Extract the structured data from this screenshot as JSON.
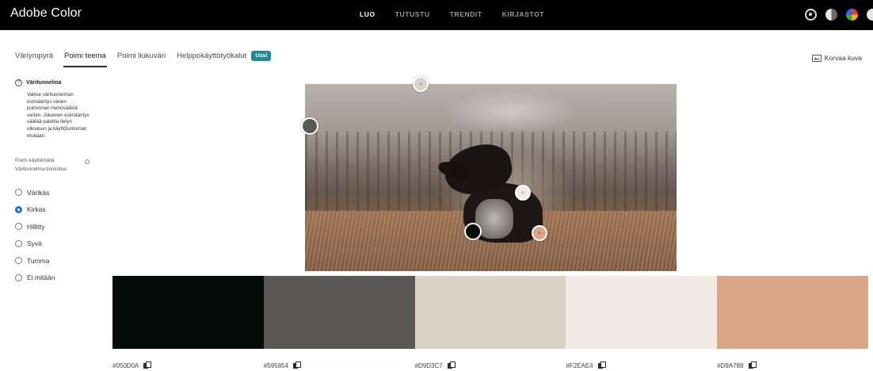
{
  "app": {
    "title": "Adobe Color"
  },
  "topnav": {
    "items": [
      "LUO",
      "TUTUSTU",
      "TRENDIT",
      "KIRJASTOT"
    ],
    "active": "LUO"
  },
  "top_icons": [
    "creative-cloud-icon",
    "contrast-icon",
    "color-wheel-icon",
    "info-icon"
  ],
  "tabs": {
    "items": [
      "Väriympyrä",
      "Poimi teema",
      "Poimi liukuväri",
      "Helppokäyttötyökalut"
    ],
    "active": "Poimi teema",
    "badge": "Uusi"
  },
  "replace_image": {
    "label": "Korvaa kuva"
  },
  "sidebar": {
    "harmony_title": "Väritunnelma",
    "harmony_description": "Valitse väritunnelman esimääritys värien poiminnan hienosäätöä varten. Jokainen esimääritys säätää palettia tietyn ulkoasun ja käyttötuntuman mukaan.",
    "pick_label": "Poimi käyttämällä Väritunnelma-toimintoa",
    "options": [
      "Värikäs",
      "Kirkas",
      "Hillitty",
      "Syvä",
      "Tumma",
      "Ei mitään"
    ],
    "selected": "Kirkas"
  },
  "picker_colors": [
    "#D9D3C7",
    "#595854",
    "#F2EAE4",
    "#050D0A",
    "#D9A788"
  ],
  "swatches": [
    {
      "color": "#050D0A",
      "hex": "#050D0A"
    },
    {
      "color": "#595854",
      "hex": "#595854"
    },
    {
      "color": "#D9D3C7",
      "hex": "#D9D3C7"
    },
    {
      "color": "#F2EAE4",
      "hex": "#F2EAE4"
    },
    {
      "color": "#D9A788",
      "hex": "#D9A788"
    }
  ],
  "colors": {
    "topbar": "#000000",
    "badge": "#1F8A8F",
    "radio_selected": "#1473E6"
  }
}
